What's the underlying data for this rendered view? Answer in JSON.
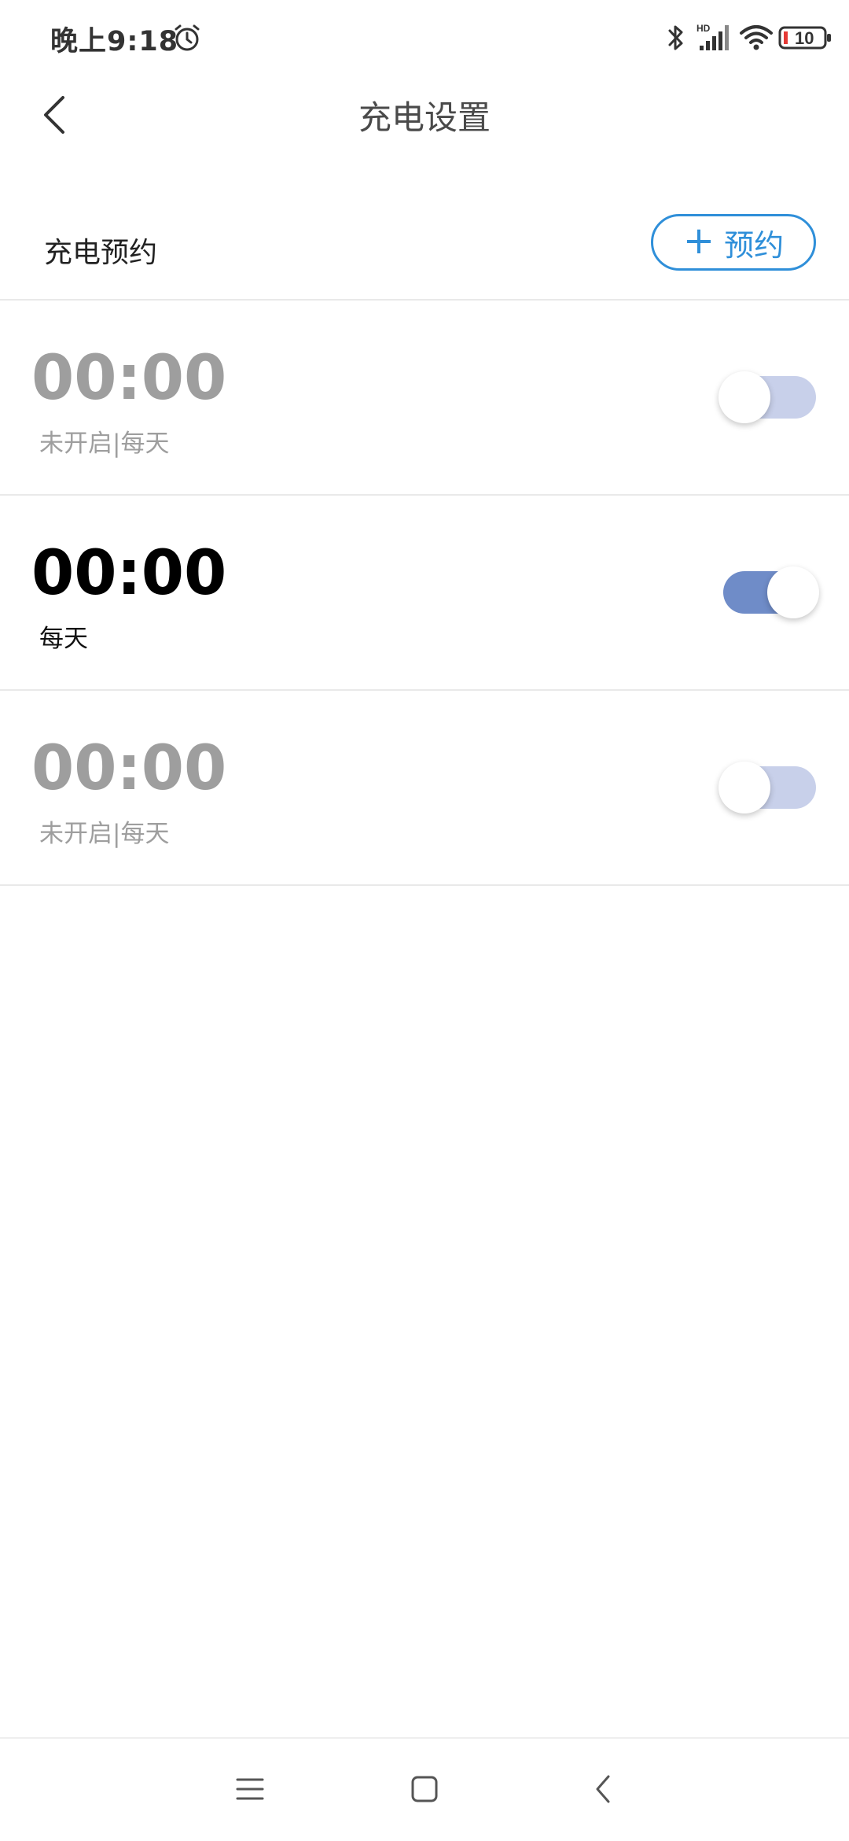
{
  "status_bar": {
    "time": "晚上9:18",
    "network_label": "HD",
    "battery_level": "10",
    "icons": [
      "alarm-icon",
      "bluetooth-icon",
      "cellular-signal-icon",
      "wifi-icon",
      "battery-icon"
    ]
  },
  "header": {
    "title": "充电设置",
    "back_icon": "chevron-left-icon"
  },
  "section": {
    "title": "充电预约",
    "add_button_icon": "plus-icon",
    "add_button_label": "预约"
  },
  "schedules": [
    {
      "time": "00:00",
      "subtitle": "未开启|每天",
      "enabled": false
    },
    {
      "time": "00:00",
      "subtitle": "每天",
      "enabled": true
    },
    {
      "time": "00:00",
      "subtitle": "未开启|每天",
      "enabled": false
    }
  ],
  "nav_bar": {
    "icons": [
      "menu-icon",
      "home-icon",
      "back-icon"
    ]
  },
  "colors": {
    "accent_blue": "#2f8fd9",
    "toggle_on_track": "#6f8cc8",
    "toggle_off_track": "#c8d0ea",
    "disabled_text": "#9e9e9e"
  }
}
